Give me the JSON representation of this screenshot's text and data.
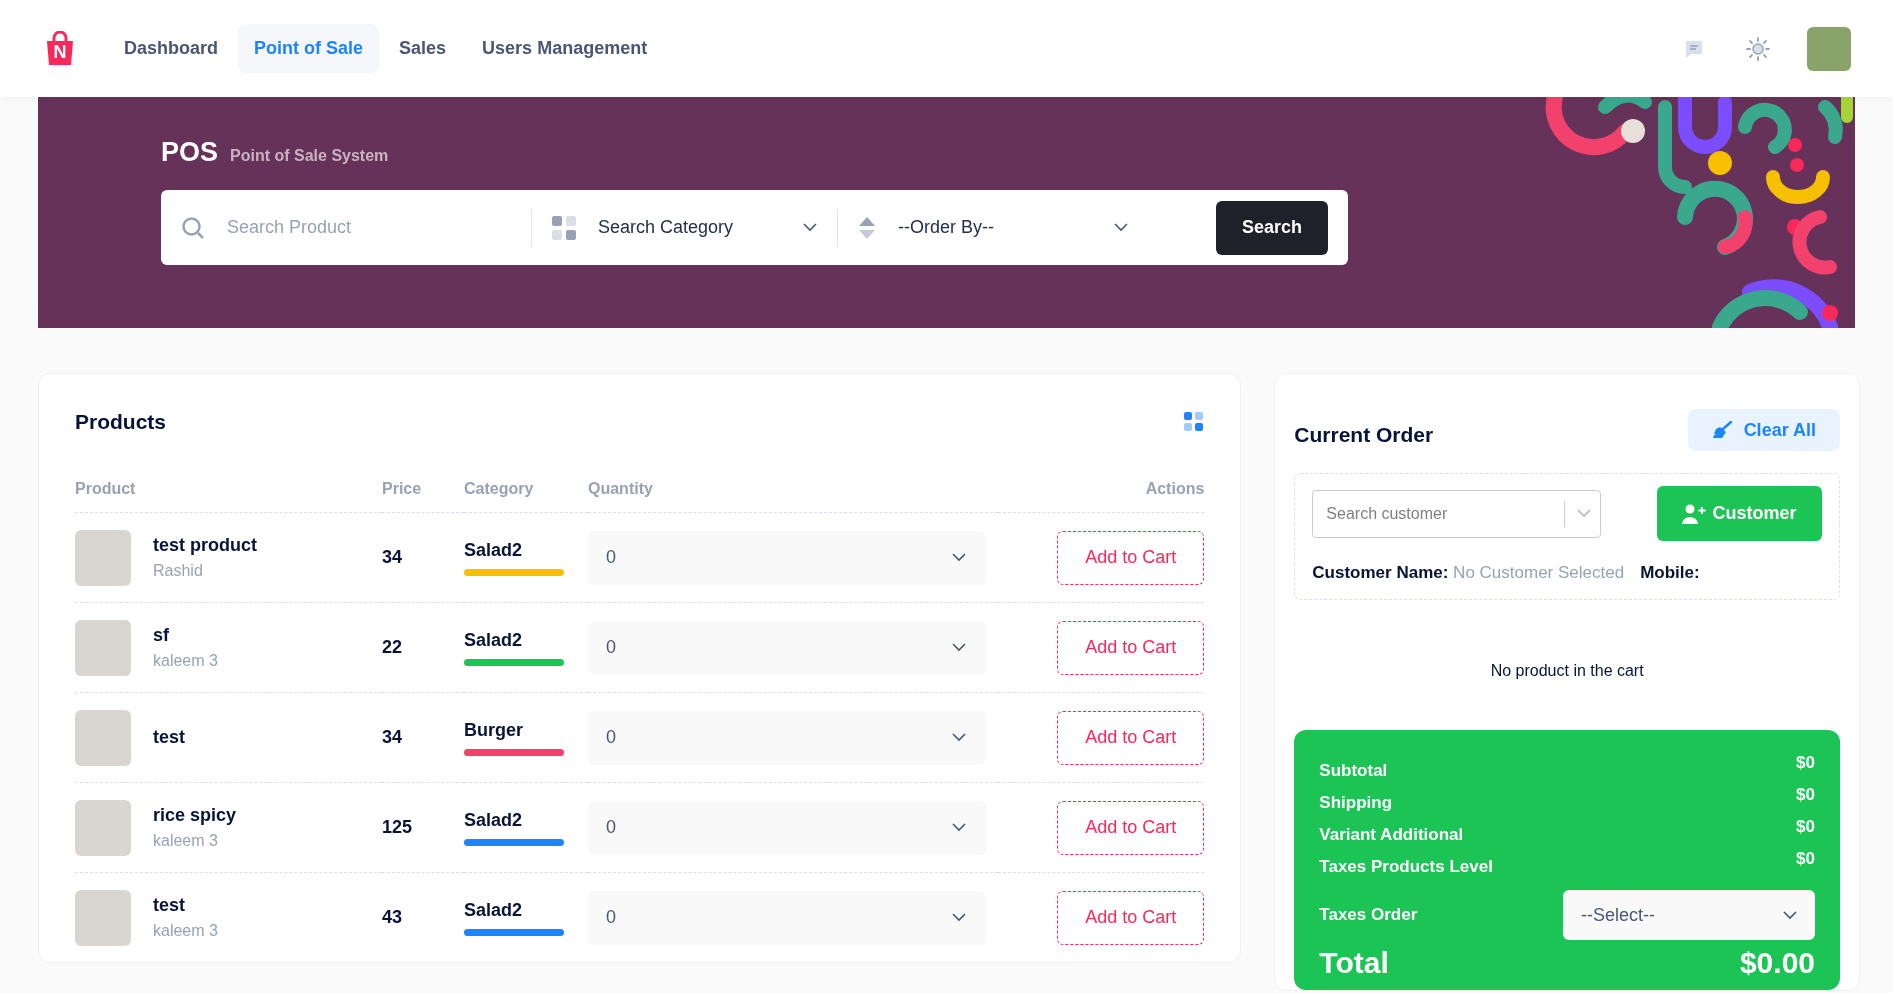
{
  "nav": {
    "logo_letter": "N",
    "items": [
      {
        "label": "Dashboard",
        "selected": false
      },
      {
        "label": "Point of Sale",
        "selected": true
      },
      {
        "label": "Sales",
        "selected": false
      },
      {
        "label": "Users Management",
        "selected": false
      }
    ]
  },
  "banner": {
    "title": "POS",
    "subtitle": "Point of Sale System",
    "search": {
      "placeholder": "Search Product"
    },
    "category": "Search Category",
    "order_by": "--Order By--",
    "search_button": "Search"
  },
  "products": {
    "title": "Products",
    "columns": [
      "Product",
      "Price",
      "Category",
      "Quantity",
      "Actions"
    ],
    "rows": [
      {
        "name": "test product",
        "owner": "Rashid",
        "price": "34",
        "category": "Salad2",
        "color": "#f6c000",
        "quantity": "0",
        "action": "Add to Cart"
      },
      {
        "name": "sf",
        "owner": "kaleem 3",
        "price": "22",
        "category": "Salad2",
        "color": "#1bc454",
        "quantity": "0",
        "action": "Add to Cart"
      },
      {
        "name": "test",
        "price": "34",
        "category": "Burger",
        "color": "#f1416c",
        "quantity": "0",
        "action": "Add to Cart"
      },
      {
        "name": "rice spicy",
        "owner": "kaleem 3",
        "price": "125",
        "category": "Salad2",
        "color": "#1b84ff",
        "quantity": "0",
        "action": "Add to Cart"
      },
      {
        "name": "test",
        "owner": "kaleem 3",
        "price": "43",
        "category": "Salad2",
        "color": "#1b84ff",
        "quantity": "0",
        "action": "Add to Cart"
      }
    ]
  },
  "order": {
    "title": "Current Order",
    "clear_button": "Clear All",
    "customer_search": {
      "placeholder": "Search customer"
    },
    "add_customer": "Customer",
    "customer_name_label": "Customer Name:",
    "customer_name_value": "No Customer Selected",
    "mobile_label": "Mobile:",
    "empty_message": "No product in the cart",
    "summary": [
      {
        "label": "Subtotal",
        "value": "$0"
      },
      {
        "label": "Shipping",
        "value": "$0"
      },
      {
        "label": "Variant Additional",
        "value": "$0"
      },
      {
        "label": "Taxes Products Level",
        "value": "$0"
      }
    ],
    "taxes_order_label": "Taxes Order",
    "taxes_select": "--Select--",
    "total_label": "Total",
    "total_value": "$0.00"
  }
}
